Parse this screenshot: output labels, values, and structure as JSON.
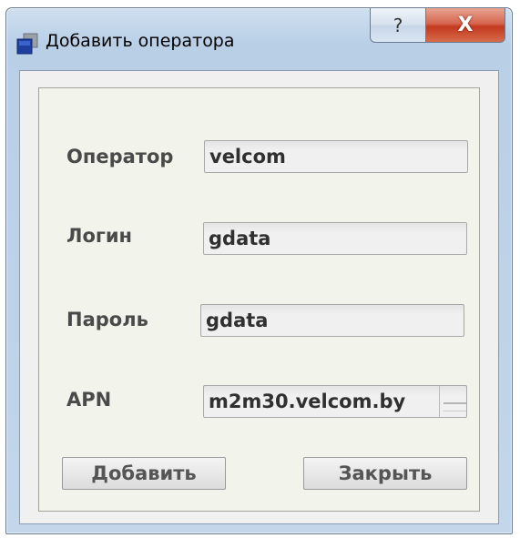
{
  "window": {
    "title": "Добавить оператора",
    "help_label": "?",
    "close_label": "X"
  },
  "form": {
    "operator": {
      "label": "Оператор",
      "value": "velcom"
    },
    "login": {
      "label": "Логин",
      "value": "gdata"
    },
    "password": {
      "label": "Пароль",
      "value": "gdata"
    },
    "apn": {
      "label": "APN",
      "value": "m2m30.velcom.by"
    }
  },
  "buttons": {
    "add": "Добавить",
    "close": "Закрыть"
  },
  "icons": {
    "app": "app-window-icon",
    "help": "help-icon",
    "close": "close-icon",
    "dropdown": "dropdown-icon"
  },
  "colors": {
    "close_button": "#c33a1e",
    "titlebar": "#b9cfe6",
    "group_background": "#f2f3ea"
  }
}
